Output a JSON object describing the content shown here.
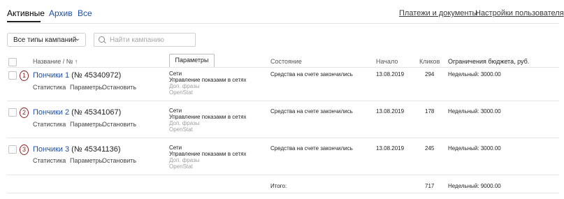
{
  "tabs": [
    {
      "label": "Активные"
    },
    {
      "label": "Архив"
    },
    {
      "label": "Все"
    }
  ],
  "top_links": {
    "payments": "Платежи и документы",
    "user_settings": "Настройки пользователя"
  },
  "filter": {
    "campaign_types": "Все типы кампаний",
    "search_placeholder": "Найти кампанию"
  },
  "table": {
    "headers": {
      "name": "Название / № ↑",
      "params_button": "Параметры",
      "status": "Состояние",
      "start": "Начало",
      "clicks": "Кликов",
      "budget": "Ограничения бюджета, руб."
    },
    "rows": [
      {
        "marker": "1",
        "name": "Пончики 1",
        "id": "(№ 45340972)",
        "actions": [
          "Статистика",
          "Параметры",
          "Остановить"
        ],
        "params": [
          "Сети",
          "Управление показами в сетях",
          "Доп. фразы",
          "OpenStat"
        ],
        "status": "Средства на счете закончились",
        "start": "13.08.2019",
        "clicks": "294",
        "budget": "Недельный: 3000.00"
      },
      {
        "marker": "2",
        "name": "Пончики 2",
        "id": "(№ 45341067)",
        "actions": [
          "Статистика",
          "Параметры",
          "Остановить"
        ],
        "params": [
          "Сети",
          "Управление показами в сетях",
          "Доп. фразы",
          "OpenStat"
        ],
        "status": "Средства на счете закончились",
        "start": "13.08.2019",
        "clicks": "178",
        "budget": "Недельный: 3000.00"
      },
      {
        "marker": "3",
        "name": "Пончики 3",
        "id": "(№ 45341136)",
        "actions": [
          "Статистика",
          "Параметры",
          "Остановить"
        ],
        "params": [
          "Сети",
          "Управление показами в сетях",
          "Доп. фразы",
          "OpenStat"
        ],
        "status": "Средства на счете закончились",
        "start": "13.08.2019",
        "clicks": "245",
        "budget": "Недельный: 3000.00"
      }
    ],
    "total": {
      "label": "Итого:",
      "clicks": "717",
      "budget": "Недельный: 9000.00"
    }
  },
  "icons": {
    "dropdown": "chevron-down-icon",
    "search": "search-icon"
  },
  "colors": {
    "link": "#1f4fa8",
    "marker": "#8b1c1c"
  }
}
